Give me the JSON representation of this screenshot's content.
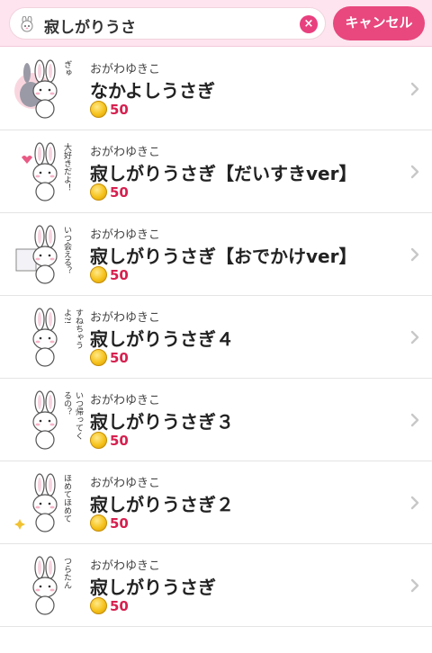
{
  "search": {
    "query": "寂しがりうさ",
    "cancel_label": "キャンセル"
  },
  "colors": {
    "accent": "#e8487e",
    "header_bg": "#fde4ee",
    "price": "#d6204f"
  },
  "results": [
    {
      "author": "おがわゆきこ",
      "title": "なかよしうさぎ",
      "price": "50",
      "thumb_text": "ぎゅ",
      "thumb_icon": "two-rabbits-hug-icon"
    },
    {
      "author": "おがわゆきこ",
      "title": "寂しがりうさぎ【だいすきver】",
      "price": "50",
      "thumb_text": "大好きだよ！",
      "thumb_icon": "rabbit-heart-icon"
    },
    {
      "author": "おがわゆきこ",
      "title": "寂しがりうさぎ【おでかけver】",
      "price": "50",
      "thumb_text": "いつ会える？",
      "thumb_icon": "rabbit-sign-icon"
    },
    {
      "author": "おがわゆきこ",
      "title": "寂しがりうさぎ４",
      "price": "50",
      "thumb_text": "すねちゃうよ?!",
      "thumb_icon": "rabbit-pout-icon"
    },
    {
      "author": "おがわゆきこ",
      "title": "寂しがりうさぎ３",
      "price": "50",
      "thumb_text": "いつ帰ってくるの？",
      "thumb_icon": "rabbit-sitting-icon"
    },
    {
      "author": "おがわゆきこ",
      "title": "寂しがりうさぎ２",
      "price": "50",
      "thumb_text": "ほめてほめて",
      "thumb_icon": "rabbit-sparkle-icon"
    },
    {
      "author": "おがわゆきこ",
      "title": "寂しがりうさぎ",
      "price": "50",
      "thumb_text": "つらたん",
      "thumb_icon": "rabbit-sad-icon"
    }
  ]
}
